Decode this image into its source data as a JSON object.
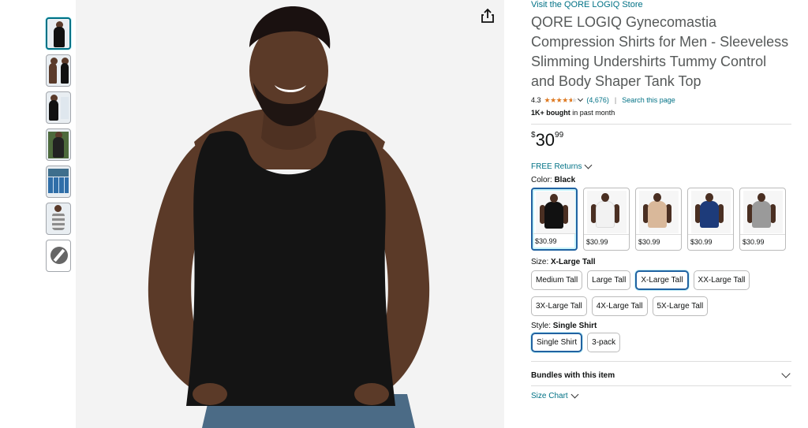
{
  "store_link": "Visit the QORE LOGIQ Store",
  "title": "QORE LOGIQ Gynecomastia Compression Shirts for Men - Sleeveless Slimming Undershirts Tummy Control and Body Shaper Tank Top",
  "rating": {
    "value": "4.3",
    "stars_fill": 0.86,
    "count": "(4,676)",
    "separator": "|",
    "search_link": "Search this page"
  },
  "bought": {
    "strong": "1K+ bought",
    "rest": " in past month"
  },
  "price": {
    "symbol": "$",
    "whole": "30",
    "fraction": "99"
  },
  "returns": "FREE Returns",
  "color": {
    "label": "Color: ",
    "selected": "Black",
    "swatches": [
      {
        "name": "Black",
        "price": "$30.99",
        "hex": "#111111"
      },
      {
        "name": "White",
        "price": "$30.99",
        "hex": "#f2f2f2"
      },
      {
        "name": "Beige",
        "price": "$30.99",
        "hex": "#d9b89a"
      },
      {
        "name": "Navy",
        "price": "$30.99",
        "hex": "#1d3b7a"
      },
      {
        "name": "Gray",
        "price": "$30.99",
        "hex": "#9a9a9a"
      }
    ]
  },
  "size": {
    "label": "Size: ",
    "selected": "X-Large Tall",
    "options": [
      "Medium Tall",
      "Large Tall",
      "X-Large Tall",
      "XX-Large Tall",
      "3X-Large Tall",
      "4X-Large Tall",
      "5X-Large Tall"
    ]
  },
  "style": {
    "label": "Style: ",
    "selected": "Single Shirt",
    "options": [
      "Single Shirt",
      "3-pack"
    ]
  },
  "bundles": "Bundles with this item",
  "size_chart": "Size Chart",
  "icons": {
    "share": "share-icon",
    "chevron": "chevron-down-icon"
  },
  "colors": {
    "link": "#007185",
    "star": "#de7921",
    "selected_border": "#2162a1"
  }
}
